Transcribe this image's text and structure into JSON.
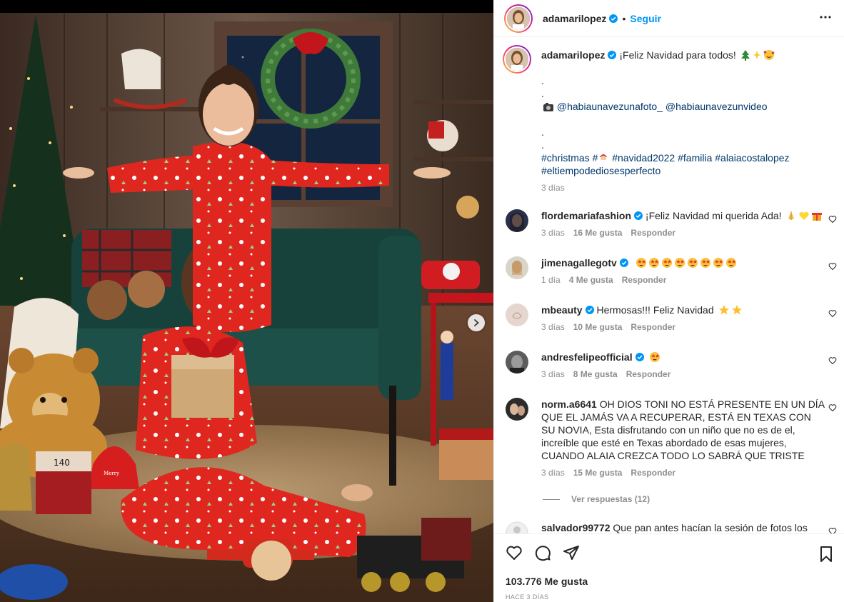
{
  "post_author": {
    "username": "adamarilopez",
    "verified": true,
    "separator": "•",
    "follow_label": "Seguir"
  },
  "caption": {
    "username": "adamarilopez",
    "text": "¡Feliz Navidad para todos!",
    "emojis": [
      "christmas-tree",
      "sparkles",
      "smiling-face-with-hearts"
    ],
    "dot_lines": [
      ".",
      "."
    ],
    "credits": "@habiaunavezunafoto_ @habiaunavezunvideo",
    "credits_icon": "camera-icon",
    "dot_lines_2": [
      ".",
      "."
    ],
    "hashtags_line1": "#christmas #",
    "hashtags_line1_rest": " #navidad2022 #familia #alaiacostalopez",
    "hashtags_line2": "#eltiempodediosesperfecto",
    "time": "3 días"
  },
  "comments": [
    {
      "username": "flordemariafashion",
      "verified": true,
      "text": "¡Feliz Navidad mi querida Ada!",
      "emojis": [
        "folded-hands",
        "yellow-heart",
        "gift"
      ],
      "time": "3 días",
      "likes": "16 Me gusta",
      "reply": "Responder"
    },
    {
      "username": "jimenagallegotv",
      "verified": true,
      "text": "",
      "emojis": [
        "star-struck",
        "star-struck",
        "star-struck",
        "star-struck",
        "star-struck",
        "star-struck",
        "star-struck",
        "star-struck"
      ],
      "time": "1 día",
      "likes": "4 Me gusta",
      "reply": "Responder"
    },
    {
      "username": "mbeauty",
      "verified": true,
      "text": "Hermosas!!! Feliz Navidad",
      "emojis": [
        "star",
        "star"
      ],
      "time": "3 días",
      "likes": "10 Me gusta",
      "reply": "Responder"
    },
    {
      "username": "andresfelipeofficial",
      "verified": true,
      "text": "",
      "emojis": [
        "star-struck"
      ],
      "time": "3 días",
      "likes": "8 Me gusta",
      "reply": "Responder"
    },
    {
      "username": "norm.a6641",
      "verified": false,
      "text": "OH DIOS TONI NO ESTÁ PRESENTE EN UN DÍA QUE EL JAMÁS VA A RECUPERAR, ESTÁ EN TEXAS CON SU NOVIA, Esta disfrutando con un niño que no es de el, increíble que esté en Texas abordado de esas mujeres, CUANDO ALAIA CREZCA TODO LO SABRÁ QUE TRISTE",
      "emojis": [],
      "time": "3 días",
      "likes": "15 Me gusta",
      "reply": "Responder"
    },
    {
      "username": "salvador99772",
      "verified": false,
      "text": "Que pan antes hacían la sesión de fotos los",
      "emojis": []
    }
  ],
  "view_replies": "Ver respuestas (12)",
  "footer": {
    "likes": "103.776 Me gusta",
    "ago": "HACE 3 DÍAS",
    "icons": [
      "heart-icon",
      "comment-icon",
      "share-icon",
      "bookmark-icon"
    ]
  },
  "photo": {
    "ornament_text": "Merry Christmas",
    "box_text": "140"
  }
}
